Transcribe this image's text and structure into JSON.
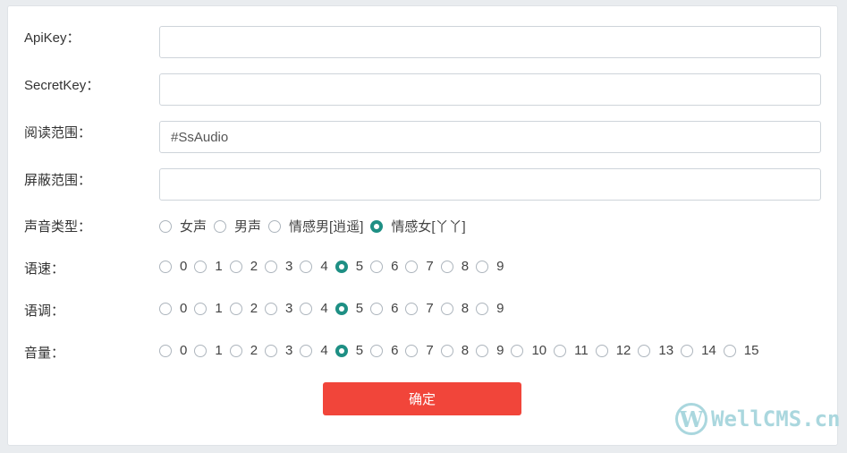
{
  "form": {
    "apikey": {
      "label": "ApiKey：",
      "value": "",
      "placeholder": ""
    },
    "secretkey": {
      "label": "SecretKey：",
      "value": "",
      "placeholder": ""
    },
    "read_scope": {
      "label": "阅读范围：",
      "value": "#SsAudio",
      "placeholder": ""
    },
    "block_scope": {
      "label": "屏蔽范围：",
      "value": "",
      "placeholder": ""
    },
    "voice_type": {
      "label": "声音类型：",
      "options": [
        "女声",
        "男声",
        "情感男[逍遥]",
        "情感女[丫丫]"
      ],
      "selected": 3
    },
    "speed": {
      "label": "语速：",
      "options": [
        "0",
        "1",
        "2",
        "3",
        "4",
        "5",
        "6",
        "7",
        "8",
        "9"
      ],
      "selected": 5
    },
    "pitch": {
      "label": "语调：",
      "options": [
        "0",
        "1",
        "2",
        "3",
        "4",
        "5",
        "6",
        "7",
        "8",
        "9"
      ],
      "selected": 5
    },
    "volume": {
      "label": "音量：",
      "options": [
        "0",
        "1",
        "2",
        "3",
        "4",
        "5",
        "6",
        "7",
        "8",
        "9",
        "10",
        "11",
        "12",
        "13",
        "14",
        "15"
      ],
      "selected": 5
    },
    "submit_label": "确定"
  },
  "watermark": {
    "letter": "W",
    "text": "WellCMS.cn"
  },
  "colors": {
    "accent": "#1e8f84",
    "submit": "#f1453a",
    "watermark": "#aad7de"
  }
}
